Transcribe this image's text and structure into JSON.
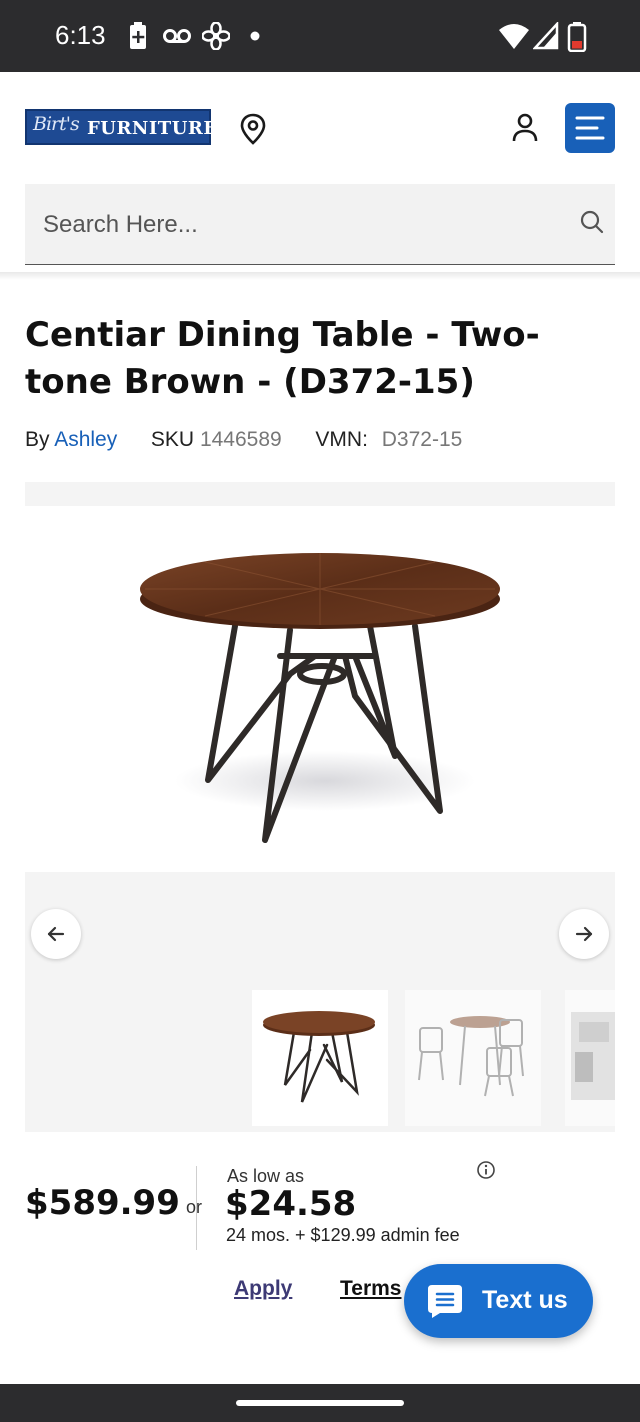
{
  "status_bar": {
    "time": "6:13",
    "icons": [
      "battery-saver-icon",
      "voicemail-icon",
      "fan-icon",
      "dot-icon",
      "wifi-icon",
      "signal-icon",
      "battery-icon"
    ]
  },
  "header": {
    "logo_script": "Birt's",
    "logo_word": "FURNITURE",
    "icons": [
      "location-pin-icon",
      "account-icon",
      "menu-icon"
    ]
  },
  "search": {
    "placeholder": "Search Here..."
  },
  "product": {
    "title": "Centiar Dining Table - Two-tone Brown - (D372-15)",
    "by_label": "By",
    "brand": "Ashley",
    "sku_label": "SKU",
    "sku": "1446589",
    "vmn_label": "VMN:",
    "vmn": "D372-15"
  },
  "gallery": {
    "thumbnail_count_visible": 3,
    "selected_thumbnail": 1
  },
  "pricing": {
    "price": "$589.99",
    "or": "or",
    "as_low_as": "As low as",
    "monthly": "$24.58",
    "terms": "24 mos. + $129.99 admin fee"
  },
  "links": {
    "apply": "Apply",
    "terms": "Terms"
  },
  "chat": {
    "label": "Text us"
  },
  "colors": {
    "brand_blue": "#1860b8",
    "chat_blue": "#1a6fcf",
    "status_bar": "#2c2c2e"
  }
}
